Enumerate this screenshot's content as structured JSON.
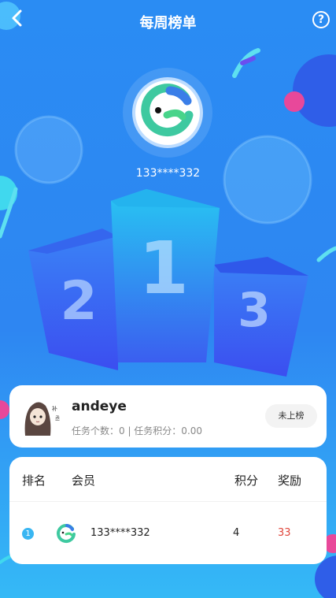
{
  "header": {
    "title": "每周榜单",
    "help_symbol": "?"
  },
  "podium": {
    "first_place_name": "133****332",
    "ranks": [
      "2",
      "1",
      "3"
    ]
  },
  "my_card": {
    "username": "andeye",
    "stats": "任务个数：0 | 任务积分：0.00",
    "rank_status": "未上榜"
  },
  "leaderboard": {
    "columns": {
      "rank": "排名",
      "member": "会员",
      "points": "积分",
      "reward": "奖励"
    },
    "rows": [
      {
        "rank": "1",
        "member": "133****332",
        "points": "4",
        "reward": "33"
      }
    ]
  },
  "colors": {
    "accent": "#2e86f2",
    "reward": "#e0453a",
    "badge": "#39b6f2"
  }
}
